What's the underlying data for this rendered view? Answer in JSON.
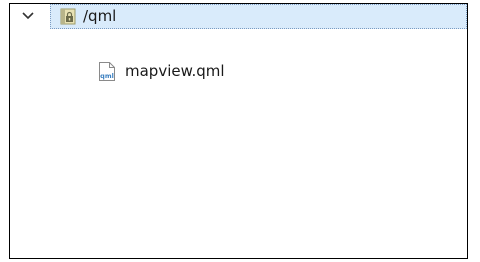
{
  "tree": {
    "root": {
      "label": "/qml",
      "expanded": true,
      "icon": "resource-folder-icon"
    },
    "children": [
      {
        "label": "mapview.qml",
        "icon": "qml-file-icon",
        "icon_text": "qml"
      }
    ]
  },
  "colors": {
    "selection_background": "#d9ebfb",
    "selection_border": "#7a9bc2",
    "qml_icon_text": "#3a7fc0"
  }
}
